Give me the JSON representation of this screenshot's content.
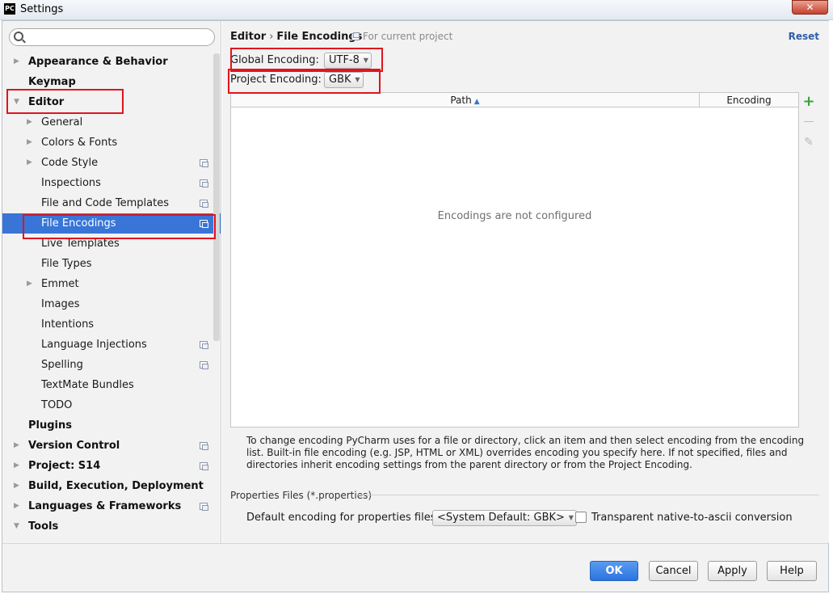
{
  "window": {
    "title": "Settings",
    "app_icon": "PC",
    "close_label": "✕"
  },
  "search": {
    "placeholder": ""
  },
  "sidebar": {
    "items": [
      {
        "label": "Appearance & Behavior",
        "level": 0,
        "arrow": "collapsed",
        "bold": true,
        "project_icon": false,
        "selected": false
      },
      {
        "label": "Keymap",
        "level": 0,
        "arrow": "none",
        "bold": true,
        "project_icon": false,
        "selected": false
      },
      {
        "label": "Editor",
        "level": 0,
        "arrow": "expanded",
        "bold": true,
        "project_icon": false,
        "selected": false
      },
      {
        "label": "General",
        "level": 1,
        "arrow": "collapsed",
        "bold": false,
        "project_icon": false,
        "selected": false
      },
      {
        "label": "Colors & Fonts",
        "level": 1,
        "arrow": "collapsed",
        "bold": false,
        "project_icon": false,
        "selected": false
      },
      {
        "label": "Code Style",
        "level": 1,
        "arrow": "collapsed",
        "bold": false,
        "project_icon": true,
        "selected": false
      },
      {
        "label": "Inspections",
        "level": 1,
        "arrow": "none",
        "bold": false,
        "project_icon": true,
        "selected": false
      },
      {
        "label": "File and Code Templates",
        "level": 1,
        "arrow": "none",
        "bold": false,
        "project_icon": true,
        "selected": false
      },
      {
        "label": "File Encodings",
        "level": 1,
        "arrow": "none",
        "bold": false,
        "project_icon": true,
        "selected": true
      },
      {
        "label": "Live Templates",
        "level": 1,
        "arrow": "none",
        "bold": false,
        "project_icon": false,
        "selected": false
      },
      {
        "label": "File Types",
        "level": 1,
        "arrow": "none",
        "bold": false,
        "project_icon": false,
        "selected": false
      },
      {
        "label": "Emmet",
        "level": 1,
        "arrow": "collapsed",
        "bold": false,
        "project_icon": false,
        "selected": false
      },
      {
        "label": "Images",
        "level": 1,
        "arrow": "none",
        "bold": false,
        "project_icon": false,
        "selected": false
      },
      {
        "label": "Intentions",
        "level": 1,
        "arrow": "none",
        "bold": false,
        "project_icon": false,
        "selected": false
      },
      {
        "label": "Language Injections",
        "level": 1,
        "arrow": "none",
        "bold": false,
        "project_icon": true,
        "selected": false
      },
      {
        "label": "Spelling",
        "level": 1,
        "arrow": "none",
        "bold": false,
        "project_icon": true,
        "selected": false
      },
      {
        "label": "TextMate Bundles",
        "level": 1,
        "arrow": "none",
        "bold": false,
        "project_icon": false,
        "selected": false
      },
      {
        "label": "TODO",
        "level": 1,
        "arrow": "none",
        "bold": false,
        "project_icon": false,
        "selected": false
      },
      {
        "label": "Plugins",
        "level": 0,
        "arrow": "none",
        "bold": true,
        "project_icon": false,
        "selected": false
      },
      {
        "label": "Version Control",
        "level": 0,
        "arrow": "collapsed",
        "bold": true,
        "project_icon": true,
        "selected": false
      },
      {
        "label": "Project: S14",
        "level": 0,
        "arrow": "collapsed",
        "bold": true,
        "project_icon": true,
        "selected": false
      },
      {
        "label": "Build, Execution, Deployment",
        "level": 0,
        "arrow": "collapsed",
        "bold": true,
        "project_icon": false,
        "selected": false
      },
      {
        "label": "Languages & Frameworks",
        "level": 0,
        "arrow": "collapsed",
        "bold": true,
        "project_icon": true,
        "selected": false
      },
      {
        "label": "Tools",
        "level": 0,
        "arrow": "expanded",
        "bold": true,
        "project_icon": false,
        "selected": false
      }
    ]
  },
  "main": {
    "breadcrumb": {
      "section": "Editor",
      "separator": "›",
      "page": "File Encodings"
    },
    "for_current_project": "For current project",
    "reset_label": "Reset",
    "global_encoding": {
      "label": "Global Encoding:",
      "value": "UTF-8"
    },
    "project_encoding": {
      "label": "Project Encoding:",
      "value": "GBK"
    },
    "table": {
      "columns": [
        "Path",
        "Encoding"
      ],
      "sort_column": "Path",
      "sort_direction": "ascending",
      "empty_message": "Encodings are not configured"
    },
    "tools": {
      "add": "+",
      "remove": "—",
      "edit": "✎"
    },
    "help_text": "To change encoding PyCharm uses for a file or directory, click an item and then select encoding from the encoding list. Built-in file encoding (e.g. JSP, HTML or XML) overrides encoding you specify here. If not specified, files and directories inherit encoding settings from the parent directory or from the Project Encoding.",
    "properties": {
      "section_label": "Properties Files (*.properties)",
      "default_label": "Default encoding for properties files:",
      "default_value": "<System Default: GBK>",
      "transparent_label": "Transparent native-to-ascii conversion",
      "transparent_checked": false
    }
  },
  "footer": {
    "ok": "OK",
    "cancel": "Cancel",
    "apply": "Apply",
    "help": "Help"
  },
  "colors": {
    "selection": "#3875d7",
    "annotation": "#e0141e",
    "add_icon": "#3aa33a",
    "link": "#2f5fa8"
  }
}
